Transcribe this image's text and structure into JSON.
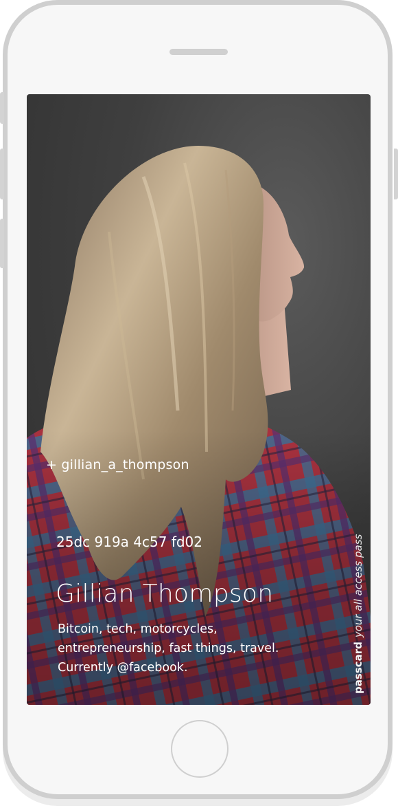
{
  "card": {
    "handle": "+ gillian_a_thompson",
    "code": "25dc 919a 4c57 fd02",
    "name": "Gillian Thompson",
    "bio": "Bitcoin, tech, motorcycles, entrepreneurship, fast things, travel. Currently @facebook."
  },
  "brand": {
    "name": "passcard",
    "tagline": "your all access pass"
  },
  "colors": {
    "background": "#3f3f3f",
    "text": "#ffffff",
    "phone_frame": "#cfcfcf"
  },
  "icons": {
    "home_button": "home-button",
    "photo": "profile-photo"
  }
}
